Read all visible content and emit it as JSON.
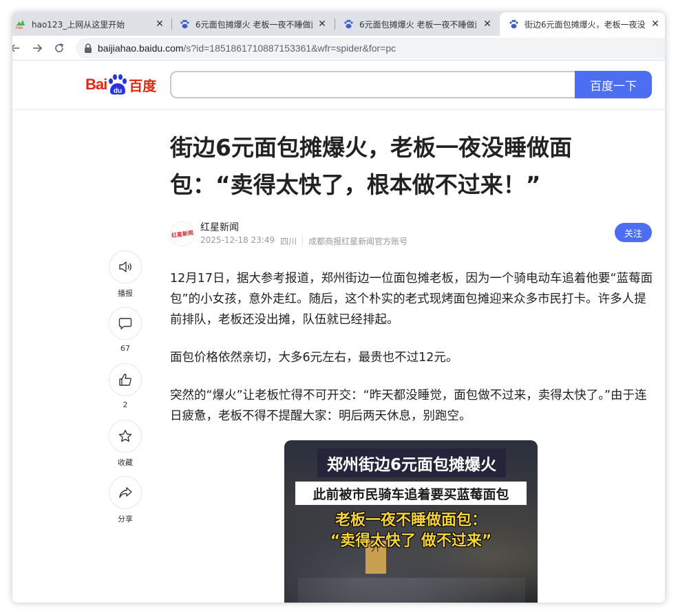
{
  "tabs": [
    {
      "title": "hao123_上网从这里开始",
      "icon": "hao123-icon"
    },
    {
      "title": "6元面包摊爆火 老板一夜不睡做面",
      "icon": "baidu-paw-icon"
    },
    {
      "title": "6元面包摊爆火 老板一夜不睡做面",
      "icon": "baidu-paw-icon"
    },
    {
      "title": "街边6元面包摊爆火，老板一夜没",
      "icon": "baidu-paw-icon",
      "active": true
    }
  ],
  "toolbar": {
    "url_host": "baijiahao.baidu.com",
    "url_path": "/s?id=1851861710887153361&wfr=spider&for=pc"
  },
  "header": {
    "logo_text_latin": "Bai",
    "logo_text_du": "du",
    "logo_text_cn": "百度",
    "search_value": "",
    "search_button": "百度一下"
  },
  "article": {
    "title": "街边6元面包摊爆火，老板一夜没睡做面包：“卖得太快了，根本做不过来！”",
    "author": {
      "name": "红星新闻",
      "avatar_text": "红星新闻",
      "date": "2025-12-18 23:49",
      "location": "四川",
      "account": "成都商报红星新闻官方账号",
      "follow": "关注"
    },
    "paragraphs": [
      "12月17日，据大参考报道，郑州街边一位面包摊老板，因为一个骑电动车追着他要“蓝莓面包”的小女孩，意外走红。随后，这个朴实的老式现烤面包摊迎来众多市民打卡。许多人提前排队，老板还没出摊，队伍就已经排起。",
      "面包价格依然亲切，大多6元左右，最贵也不过12元。",
      "突然的“爆火”让老板忙得不可开交：“昨天都没睡觉，面包做不过来，卖得太快了。”由于连日疲惫，老板不得不提醒大家：明后两天休息，别跑空。"
    ],
    "video": {
      "caption1": "郑州街边6元面包摊爆火",
      "caption2": "此前被市民骑车追着要买蓝莓面包",
      "caption3_line1": "老板一夜不睡做面包：",
      "caption3_line2": "“卖得太快了 做不过来”",
      "sign_text": "升"
    }
  },
  "side_actions": [
    {
      "label": "播报",
      "icon": "speaker-icon"
    },
    {
      "label": "67",
      "icon": "comment-icon"
    },
    {
      "label": "2",
      "icon": "thumbs-up-icon"
    },
    {
      "label": "收藏",
      "icon": "star-icon"
    },
    {
      "label": "分享",
      "icon": "share-icon"
    }
  ],
  "colors": {
    "baidu_blue": "#4e6ef2",
    "baidu_red": "#de2910",
    "tabbar": "#dee1e6"
  }
}
